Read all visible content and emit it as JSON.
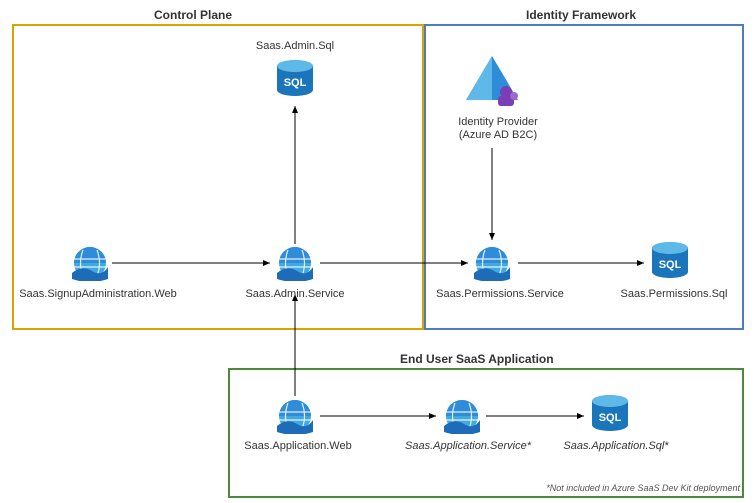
{
  "groups": {
    "controlPlane": {
      "title": "Control Plane",
      "color": "#D9A300"
    },
    "identityFramework": {
      "title": "Identity Framework",
      "color": "#4A7EBB"
    },
    "endUserApp": {
      "title": "End User SaaS Application",
      "color": "#4B8A3A"
    }
  },
  "nodes": {
    "signupWeb": {
      "label": "Saas.SignupAdministration.Web"
    },
    "adminSql": {
      "label": "Saas.Admin.Sql"
    },
    "adminService": {
      "label": "Saas.Admin.Service"
    },
    "identityProvider": {
      "label_line1": "Identity Provider",
      "label_line2": "(Azure AD B2C)"
    },
    "permService": {
      "label": "Saas.Permissions.Service"
    },
    "permSql": {
      "label": "Saas.Permissions.Sql"
    },
    "appWeb": {
      "label": "Saas.Application.Web"
    },
    "appService": {
      "label": "Saas.Application.Service*"
    },
    "appSql": {
      "label": "Saas.Application.Sql*"
    }
  },
  "footnote": "*Not included in Azure SaaS Dev Kit deployment",
  "colors": {
    "azureBlue": "#2F8CD8",
    "sqlBlue": "#1B75BB",
    "arrow": "#000000"
  }
}
